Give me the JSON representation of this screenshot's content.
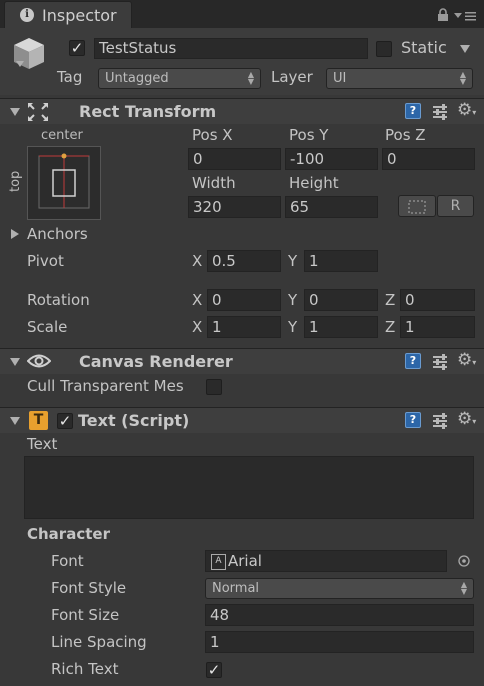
{
  "window": {
    "tab_title": "Inspector",
    "info_icon": "i"
  },
  "gameobject": {
    "name": "TestStatus",
    "static_label": "Static",
    "tag_label": "Tag",
    "tag_value": "Untagged",
    "layer_label": "Layer",
    "layer_value": "UI"
  },
  "rect_transform": {
    "title": "Rect Transform",
    "anchor_h": "center",
    "anchor_v": "top",
    "pos_x_label": "Pos X",
    "pos_y_label": "Pos Y",
    "pos_z_label": "Pos Z",
    "pos_x": "0",
    "pos_y": "-100",
    "pos_z": "0",
    "width_label": "Width",
    "height_label": "Height",
    "width": "320",
    "height": "65",
    "r_button": "R",
    "anchors_label": "Anchors",
    "pivot_label": "Pivot",
    "pivot_x": "0.5",
    "pivot_y": "1",
    "rotation_label": "Rotation",
    "rot_x": "0",
    "rot_y": "0",
    "rot_z": "0",
    "scale_label": "Scale",
    "scale_x": "1",
    "scale_y": "1",
    "scale_z": "1",
    "x": "X",
    "y": "Y",
    "z": "Z"
  },
  "canvas_renderer": {
    "title": "Canvas Renderer",
    "cull_label": "Cull Transparent Mes"
  },
  "text_script": {
    "title": "Text (Script)",
    "text_label": "Text",
    "text_value": "",
    "character_label": "Character",
    "font_label": "Font",
    "font_value": "Arial",
    "font_style_label": "Font Style",
    "font_style_value": "Normal",
    "font_size_label": "Font Size",
    "font_size_value": "48",
    "line_spacing_label": "Line Spacing",
    "line_spacing_value": "1",
    "rich_text_label": "Rich Text"
  },
  "icons": [
    "info-icon",
    "lock-icon",
    "menu-icon",
    "cube-icon",
    "rect-transform-icon",
    "help-icon",
    "preset-icon",
    "gear-icon",
    "eye-icon",
    "text-component-icon",
    "font-asset-icon",
    "object-picker-icon",
    "blueprint-icon"
  ],
  "colors": {
    "background": "#383838",
    "field": "#2a2a2a",
    "help_blue": "#2c66a8",
    "text_icon_orange": "#e8a02e"
  }
}
